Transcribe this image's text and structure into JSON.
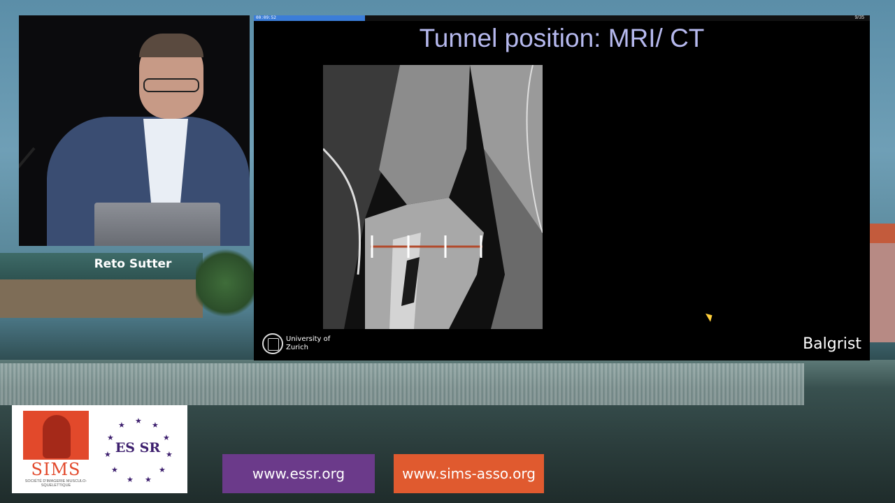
{
  "speaker": {
    "name": "Reto Sutter"
  },
  "slide": {
    "timecode": "00:09:52",
    "page_counter": "9/35",
    "title": "Tunnel position: MRI/ CT",
    "progress_fraction": 0.18,
    "uzh_label": "University of Zurich",
    "uzh_suffix": "UZH",
    "brand": "Balgrist"
  },
  "logos": {
    "sims_name": "SIMS",
    "sims_subtitle": "SOCIÉTÉ D'IMAGERIE MUSCULO-SQUELETTIQUE",
    "essr_name": "ES SR"
  },
  "links": {
    "essr_url": "www.essr.org",
    "sims_url": "www.sims-asso.org"
  },
  "colors": {
    "title": "#b6b9ee",
    "essr_purple": "#6b3a8a",
    "sims_orange": "#e05a2f",
    "progress": "#3b7dd8"
  }
}
